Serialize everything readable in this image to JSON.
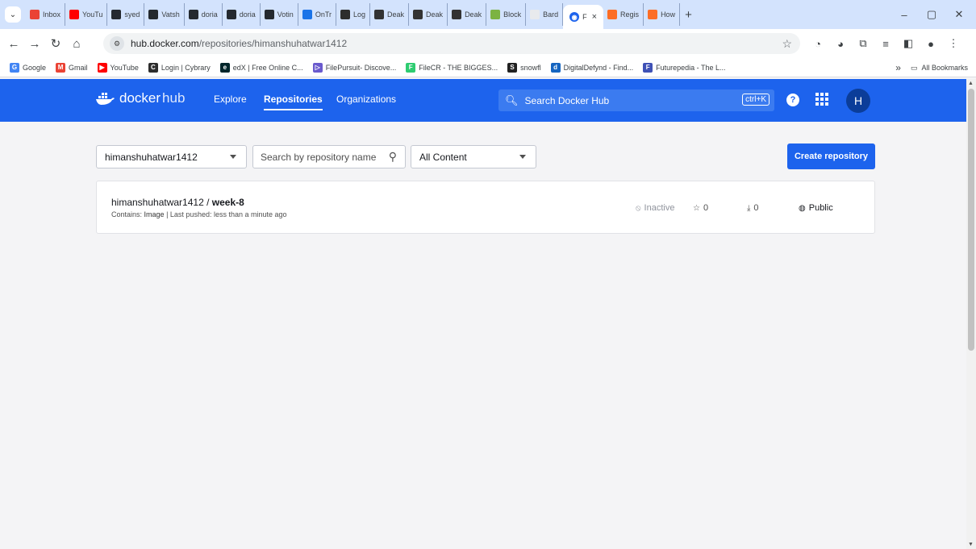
{
  "browser": {
    "tabs": [
      {
        "label": "Inbox",
        "icon": "gmail-icon",
        "color": "#ea4335"
      },
      {
        "label": "YouTu",
        "icon": "youtube-icon",
        "color": "#ff0000"
      },
      {
        "label": "syed",
        "icon": "github-icon",
        "color": "#24292f"
      },
      {
        "label": "Vatsh",
        "icon": "github-icon",
        "color": "#24292f"
      },
      {
        "label": "doria",
        "icon": "github-icon",
        "color": "#24292f"
      },
      {
        "label": "doria",
        "icon": "github-icon",
        "color": "#24292f"
      },
      {
        "label": "Votin",
        "icon": "github-icon",
        "color": "#24292f"
      },
      {
        "label": "OnTr",
        "icon": "ontrack-icon",
        "color": "#1a73e8"
      },
      {
        "label": "Log",
        "icon": "n-icon",
        "color": "#2d2d2d"
      },
      {
        "label": "Deak",
        "icon": "deakin-icon",
        "color": "#333333"
      },
      {
        "label": "Deak",
        "icon": "deakin-icon",
        "color": "#333333"
      },
      {
        "label": "Deak",
        "icon": "deakin-icon",
        "color": "#333333"
      },
      {
        "label": "Block",
        "icon": "block-icon",
        "color": "#7cb342"
      },
      {
        "label": "Bard",
        "icon": "bard-icon",
        "color": "#e8eaed"
      }
    ],
    "active_tab": {
      "label": "F",
      "close": "×"
    },
    "trailing_tabs": [
      {
        "label": "Regis",
        "icon": "gitlab-icon",
        "color": "#fc6d26"
      },
      {
        "label": "How",
        "icon": "gitlab-icon",
        "color": "#fc6d26"
      }
    ],
    "new_tab": "+",
    "url_host": "hub.docker.com",
    "url_path": "/repositories/himanshuhatwar1412",
    "bookmarks": [
      {
        "label": "Google",
        "icon": "google-icon",
        "color": "#4285f4",
        "glyph": "G"
      },
      {
        "label": "Gmail",
        "icon": "gmail-icon",
        "color": "#ea4335",
        "glyph": "M"
      },
      {
        "label": "YouTube",
        "icon": "youtube-icon",
        "color": "#ff0000",
        "glyph": "▶"
      },
      {
        "label": "Login | Cybrary",
        "icon": "cybrary-icon",
        "color": "#2d2d2d",
        "glyph": "C"
      },
      {
        "label": "edX | Free Online C...",
        "icon": "edx-icon",
        "color": "#02262b",
        "glyph": "e"
      },
      {
        "label": "FilePursuit- Discove...",
        "icon": "filepursuit-icon",
        "color": "#6a5acd",
        "glyph": "▷"
      },
      {
        "label": "FileCR - THE BIGGES...",
        "icon": "filecr-icon",
        "color": "#2ecc71",
        "glyph": "F"
      },
      {
        "label": "snowfl",
        "icon": "snowfl-icon",
        "color": "#222222",
        "glyph": "S"
      },
      {
        "label": "DigitalDefynd - Find...",
        "icon": "digitaldefynd-icon",
        "color": "#1565c0",
        "glyph": "d"
      },
      {
        "label": "Futurepedia - The L...",
        "icon": "futurepedia-icon",
        "color": "#3f51b5",
        "glyph": "F"
      }
    ],
    "more_bookmarks": "»",
    "all_bookmarks": "All Bookmarks"
  },
  "header": {
    "logo_docker": "docker",
    "logo_hub": "hub",
    "nav": [
      "Explore",
      "Repositories",
      "Organizations"
    ],
    "search_placeholder": "Search Docker Hub",
    "search_shortcut": "ctrl+K",
    "help": "?",
    "avatar_initial": "H",
    "brand_color": "#1d63ed"
  },
  "filters": {
    "namespace": "himanshuhatwar1412",
    "search_placeholder": "Search by repository name",
    "content": "All Content",
    "create_label": "Create repository"
  },
  "repositories": [
    {
      "namespace": "himanshuhatwar1412",
      "separator": " / ",
      "name": "week-8",
      "contains_label": "Contains:",
      "contains_value": "Image",
      "last_pushed": "| Last pushed: less than a minute ago",
      "status": "Inactive",
      "stars": "0",
      "pulls": "0",
      "visibility": "Public"
    }
  ]
}
